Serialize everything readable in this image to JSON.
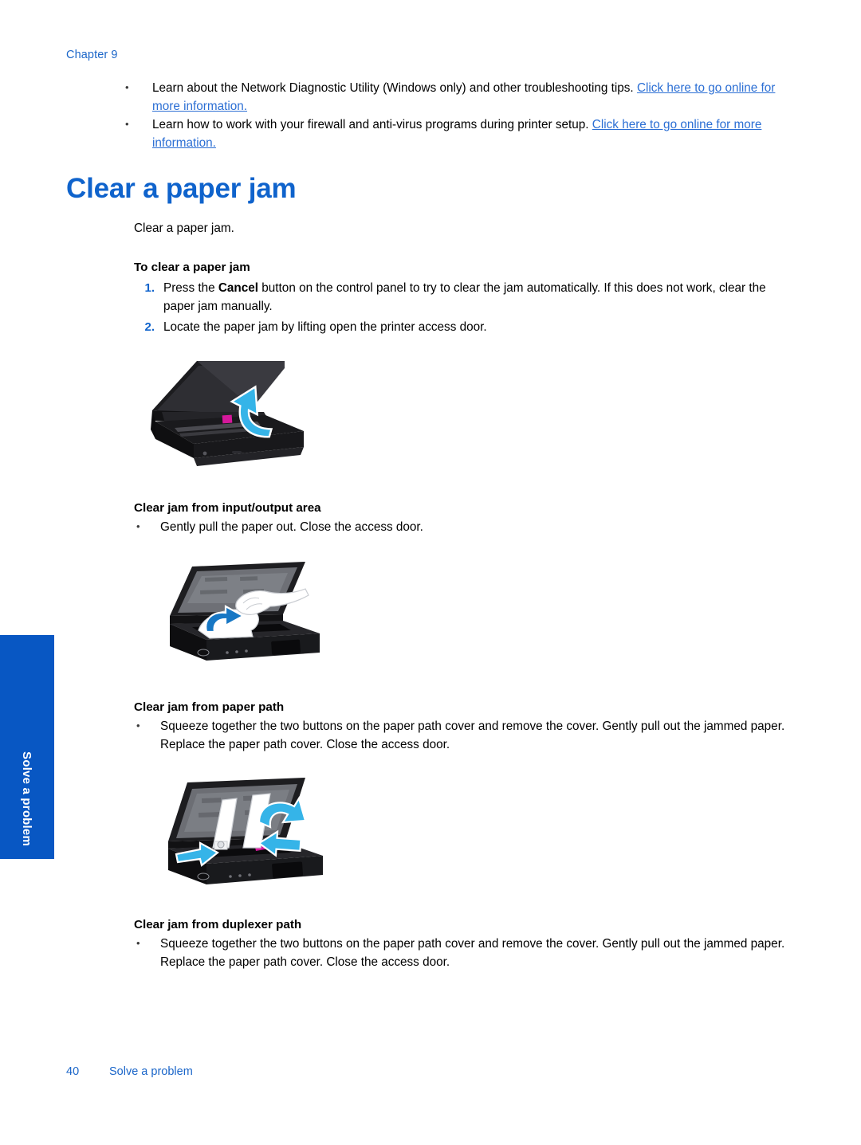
{
  "document": {
    "chapter_label": "Chapter 9",
    "side_tab_label": "Solve a problem",
    "footer": {
      "page_number": "40",
      "section_name": "Solve a problem"
    },
    "colors": {
      "heading_blue": "#0F63CC",
      "link_blue": "#2C6FD4",
      "tab_blue": "#0857C3",
      "arrow_cyan": "#35B4E8",
      "arrow_blue": "#1777C4",
      "magenta_cartridge": "#D5189B"
    }
  },
  "top_bullets": [
    {
      "text_before": "Learn about the Network Diagnostic Utility (Windows only) and other troubleshooting tips. ",
      "link_text": "Click here to go online for more information."
    },
    {
      "text_before": "Learn how to work with your firewall and anti-virus programs during printer setup. ",
      "link_text": "Click here to go online for more information."
    }
  ],
  "title": "Clear a paper jam",
  "intro": "Clear a paper jam.",
  "procedure": {
    "heading": "To clear a paper jam",
    "steps": [
      {
        "part1": "Press the ",
        "bold": "Cancel",
        "part2": " button on the control panel to try to clear the jam automatically. If this does not work, clear the paper jam manually."
      },
      {
        "part1": "Locate the paper jam by lifting open the printer access door.",
        "bold": "",
        "part2": ""
      }
    ]
  },
  "figures": {
    "open_door": {
      "name": "printer-open-access-door-illustration",
      "alt": "Printer with access door lifted open and a cyan arrow showing the upward lift direction"
    },
    "input_output": {
      "name": "printer-pull-paper-illustration",
      "alt": "Hand gently pulling jammed paper out of the input/output area with a blue arrow"
    },
    "paper_path": {
      "name": "printer-paper-path-cover-illustration",
      "alt": "Squeezing the two buttons on the paper path cover and removing the cover, with blue arrows"
    }
  },
  "sections": [
    {
      "heading": "Clear jam from input/output area",
      "bullet": "Gently pull the paper out. Close the access door."
    },
    {
      "heading": "Clear jam from paper path",
      "bullet": "Squeeze together the two buttons on the paper path cover and remove the cover. Gently pull out the jammed paper. Replace the paper path cover. Close the access door."
    },
    {
      "heading": "Clear jam from duplexer path",
      "bullet": "Squeeze together the two buttons on the paper path cover and remove the cover. Gently pull out the jammed paper. Replace the paper path cover. Close the access door."
    }
  ]
}
